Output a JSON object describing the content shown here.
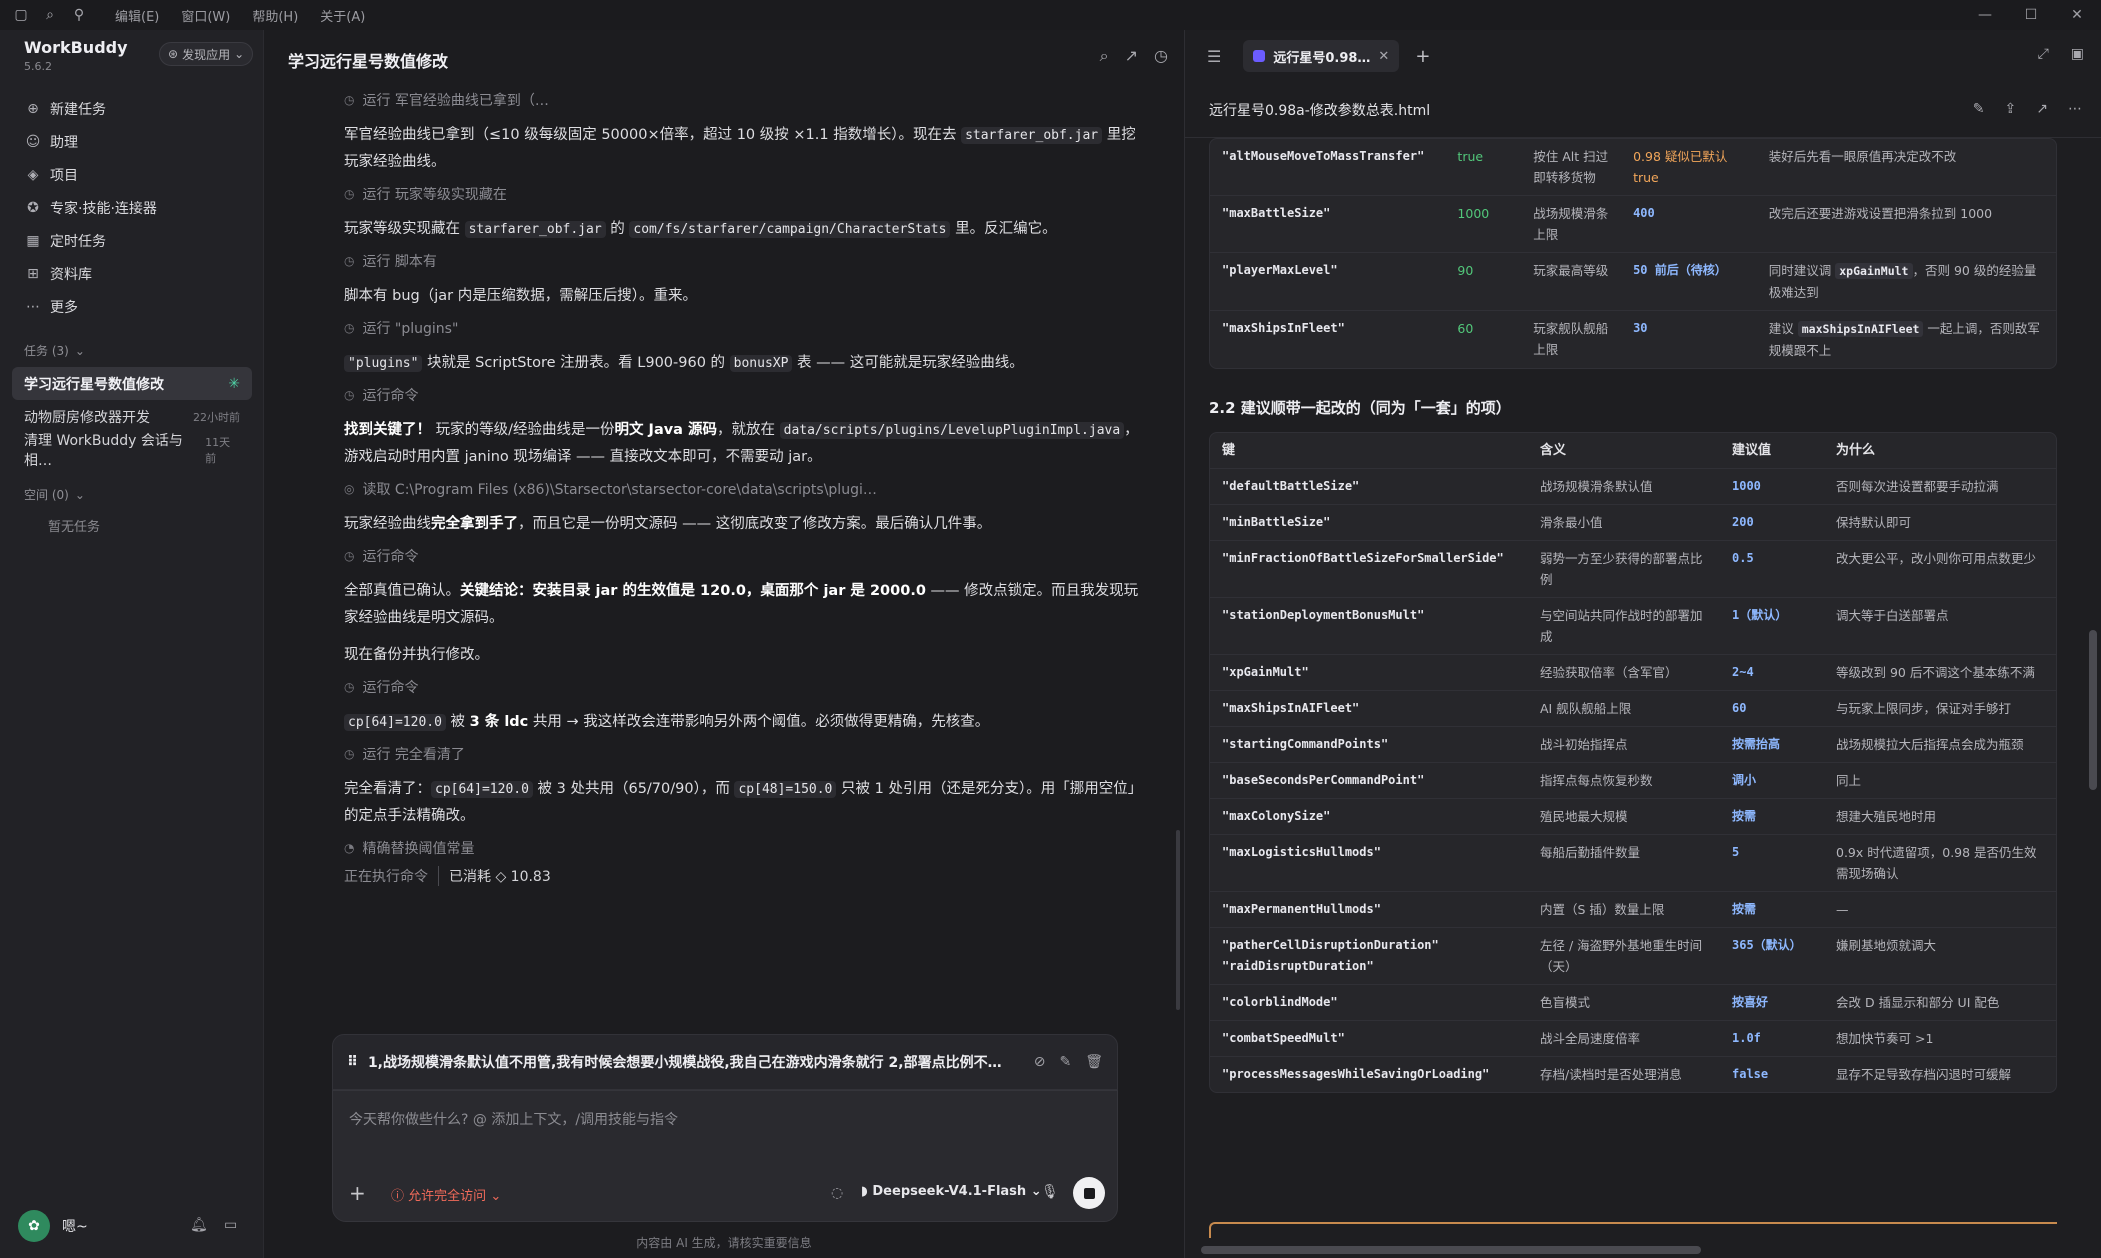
{
  "titlebar": {
    "menus": [
      "编辑(E)",
      "窗口(W)",
      "帮助(H)",
      "关于(A)"
    ]
  },
  "sidebar": {
    "app_name": "WorkBuddy",
    "version": "5.6.2",
    "discover_label": "发现应用",
    "nav": [
      {
        "icon": "plus-circle-icon",
        "glyph": "⊕",
        "label": "新建任务"
      },
      {
        "icon": "assistant-icon",
        "glyph": "☺",
        "label": "助理"
      },
      {
        "icon": "project-icon",
        "glyph": "◈",
        "label": "项目"
      },
      {
        "icon": "expert-icon",
        "glyph": "✪",
        "label": "专家·技能·连接器"
      },
      {
        "icon": "calendar-icon",
        "glyph": "▦",
        "label": "定时任务"
      },
      {
        "icon": "book-icon",
        "glyph": "⊞",
        "label": "资料库"
      },
      {
        "icon": "more-icon",
        "glyph": "⋯",
        "label": "更多"
      }
    ],
    "tasks_header": "任务 (3)",
    "tasks": [
      {
        "label": "学习远行星号数值修改",
        "when": ""
      },
      {
        "label": "动物厨房修改器开发",
        "when": "22小时前"
      },
      {
        "label": "清理 WorkBuddy 会话与相…",
        "when": "11天前"
      }
    ],
    "space_header": "空间 (0)",
    "space_empty": "暂无任务",
    "user_name": "嗯~"
  },
  "chat": {
    "title": "学习远行星号数值修改",
    "steps": [
      {
        "type": "step",
        "text": "运行 军官经验曲线已拿到（…"
      },
      {
        "type": "para",
        "html": "军官经验曲线已拿到（≤10 级每级固定 50000×倍率，超过 10 级按 ×1.1 指数增长）。现在去 <code>starfarer_obf.jar</code> 里挖玩家经验曲线。"
      },
      {
        "type": "step",
        "text": "运行 玩家等级实现藏在"
      },
      {
        "type": "para",
        "html": "玩家等级实现藏在 <code>starfarer_obf.jar</code> 的 <code>com/fs/starfarer/campaign/CharacterStats</code> 里。反汇编它。"
      },
      {
        "type": "step",
        "text": "运行 脚本有"
      },
      {
        "type": "para",
        "html": "脚本有 bug（jar 内是压缩数据，需解压后搜）。重来。"
      },
      {
        "type": "step",
        "text": "运行 \"plugins\""
      },
      {
        "type": "para",
        "html": "<code>\"plugins\"</code> 块就是 ScriptStore 注册表。看 L900-960 的 <code>bonusXP</code> 表 —— 这可能就是玩家经验曲线。"
      },
      {
        "type": "step",
        "text": "运行命令"
      },
      {
        "type": "para",
        "html": "<b>找到关键了！</b> 玩家的等级/经验曲线是一份<b>明文 Java 源码</b>，就放在 <code>data/scripts/plugins/LevelupPluginImpl.java</code>，游戏启动时用内置 janino 现场编译 —— 直接改文本即可，不需要动 jar。"
      },
      {
        "type": "step",
        "text": "读取 C:\\Program Files (x86)\\Starsector\\starsector-core\\data\\scripts\\plugi…",
        "read": true
      },
      {
        "type": "para",
        "html": "玩家经验曲线<b>完全拿到手了</b>，而且它是一份明文源码 —— 这彻底改变了修改方案。最后确认几件事。"
      },
      {
        "type": "step",
        "text": "运行命令"
      },
      {
        "type": "para",
        "html": "全部真值已确认。<b>关键结论：安装目录 jar 的生效值是 120.0，桌面那个 jar 是 2000.0</b> —— 修改点锁定。而且我发现玩家经验曲线是明文源码。"
      },
      {
        "type": "para",
        "html": "现在备份并执行修改。"
      },
      {
        "type": "step",
        "text": "运行命令"
      },
      {
        "type": "para",
        "html": "<code>cp[64]=120.0</code> 被 <b>3 条 ldc</b> 共用 → 我这样改会连带影响另外两个阈值。必须做得更精确，先核查。"
      },
      {
        "type": "step",
        "text": "运行 完全看清了"
      },
      {
        "type": "para",
        "html": "完全看清了：<code>cp[64]=120.0</code> 被 3 处共用（65/70/90），而 <code>cp[48]=150.0</code> 只被 1 处引用（还是死分支）。用「挪用空位」的定点手法精确改。"
      },
      {
        "type": "step",
        "text": "精确替换阈值常量",
        "pending": true
      }
    ],
    "status_running": "正在执行命令",
    "status_cost": "已消耗 ◇ 10.83",
    "quote_text": "1,战场规模滑条默认值不用管,我有时候会想要小规模战役,我自己在游戏内滑条就行 2,部署点比例不…",
    "input_placeholder": "今天帮你做些什么? @ 添加上下文，/调用技能与指令",
    "permission_label": "允许完全访问",
    "model_label": "Deepseek-V4.1-Flash",
    "disclaimer": "内容由 AI 生成，请核实重要信息"
  },
  "panel": {
    "tab_label": "远行星号0.98…",
    "file_name": "远行星号0.98a-修改参数总表.html",
    "table1": [
      {
        "key": "\"altMouseMoveToMassTransfer\"",
        "default": "true",
        "meaning": "按住 Alt 扫过即转移货物",
        "value": "0.98 疑似已默认 true",
        "why": "装好后先看一眼原值再决定改不改",
        "why_code": ""
      },
      {
        "key": "\"maxBattleSize\"",
        "default": "1000",
        "meaning": "战场规模滑条上限",
        "value": "400",
        "why": "改完后还要进游戏设置把滑条拉到 1000",
        "why_code": ""
      },
      {
        "key": "\"playerMaxLevel\"",
        "default": "90",
        "meaning": "玩家最高等级",
        "value": "50 前后（待核）",
        "why_pre": "同时建议调 ",
        "why_code": "xpGainMult",
        "why_post": "，否则 90 级的经验量极难达到"
      },
      {
        "key": "\"maxShipsInFleet\"",
        "default": "60",
        "meaning": "玩家舰队舰船上限",
        "value": "30",
        "why_pre": "建议 ",
        "why_code": "maxShipsInAIFleet",
        "why_post": " 一起上调，否则敌军规模跟不上"
      }
    ],
    "section2_title": "2.2 建议顺带一起改的（同为「一套」的项）",
    "table2_headers": [
      "键",
      "含义",
      "建议值",
      "为什么"
    ],
    "table2": [
      {
        "key": "\"defaultBattleSize\"",
        "meaning": "战场规模滑条默认值",
        "value": "1000",
        "why": "否则每次进设置都要手动拉满"
      },
      {
        "key": "\"minBattleSize\"",
        "meaning": "滑条最小值",
        "value": "200",
        "why": "保持默认即可"
      },
      {
        "key": "\"minFractionOfBattleSizeForSmallerSide\"",
        "meaning": "弱势一方至少获得的部署点比例",
        "value": "0.5",
        "why": "改大更公平，改小则你可用点数更少"
      },
      {
        "key": "\"stationDeploymentBonusMult\"",
        "meaning": "与空间站共同作战时的部署加成",
        "value": "1（默认）",
        "why": "调大等于白送部署点"
      },
      {
        "key": "\"xpGainMult\"",
        "meaning": "经验获取倍率（含军官）",
        "value": "2~4",
        "why": "等级改到 90 后不调这个基本练不满"
      },
      {
        "key": "\"maxShipsInAIFleet\"",
        "meaning": "AI 舰队舰船上限",
        "value": "60",
        "why": "与玩家上限同步，保证对手够打"
      },
      {
        "key": "\"startingCommandPoints\"",
        "meaning": "战斗初始指挥点",
        "value": "按需抬高",
        "why": "战场规模拉大后指挥点会成为瓶颈"
      },
      {
        "key": "\"baseSecondsPerCommandPoint\"",
        "meaning": "指挥点每点恢复秒数",
        "value": "调小",
        "why": "同上"
      },
      {
        "key": "\"maxColonySize\"",
        "meaning": "殖民地最大规模",
        "value": "按需",
        "why": "想建大殖民地时用"
      },
      {
        "key": "\"maxLogisticsHullmods\"",
        "meaning": "每船后勤插件数量",
        "value": "5",
        "why": "0.9x 时代遗留项，0.98 是否仍生效需现场确认"
      },
      {
        "key": "\"maxPermanentHullmods\"",
        "meaning": "内置（S 插）数量上限",
        "value": "按需",
        "why": "—"
      },
      {
        "key": "\"patherCellDisruptionDuration\"\n\"raidDisruptDuration\"",
        "meaning": "左径 / 海盗野外基地重生时间（天）",
        "value": "365（默认）",
        "why": "嫌刷基地烦就调大"
      },
      {
        "key": "\"colorblindMode\"",
        "meaning": "色盲模式",
        "value": "按喜好",
        "why": "会改 D 插显示和部分 UI 配色"
      },
      {
        "key": "\"combatSpeedMult\"",
        "meaning": "战斗全局速度倍率",
        "value": "1.0f",
        "why": "想加快节奏可 >1"
      },
      {
        "key": "\"processMessagesWhileSavingOrLoading\"",
        "meaning": "存档/读档时是否处理消息",
        "value": "false",
        "why": "显存不足导致存档闪退时可缓解"
      }
    ]
  }
}
